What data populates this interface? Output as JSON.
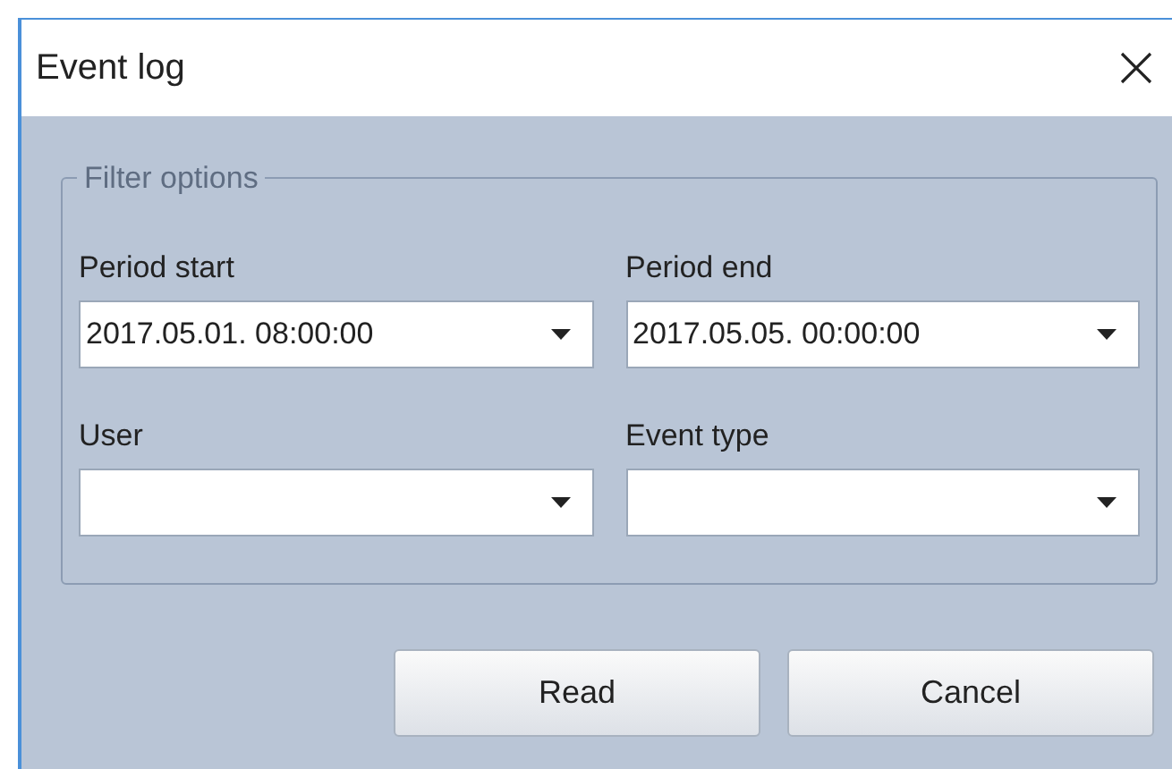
{
  "window": {
    "title": "Event log"
  },
  "filter_group": {
    "legend": "Filter options",
    "fields": [
      {
        "label": "Period start",
        "value": "2017.05.01. 08:00:00"
      },
      {
        "label": "Period end",
        "value": "2017.05.05. 00:00:00"
      },
      {
        "label": "User"
      },
      {
        "label": "Event type"
      }
    ]
  },
  "buttons": [
    "Read",
    "Cancel"
  ]
}
